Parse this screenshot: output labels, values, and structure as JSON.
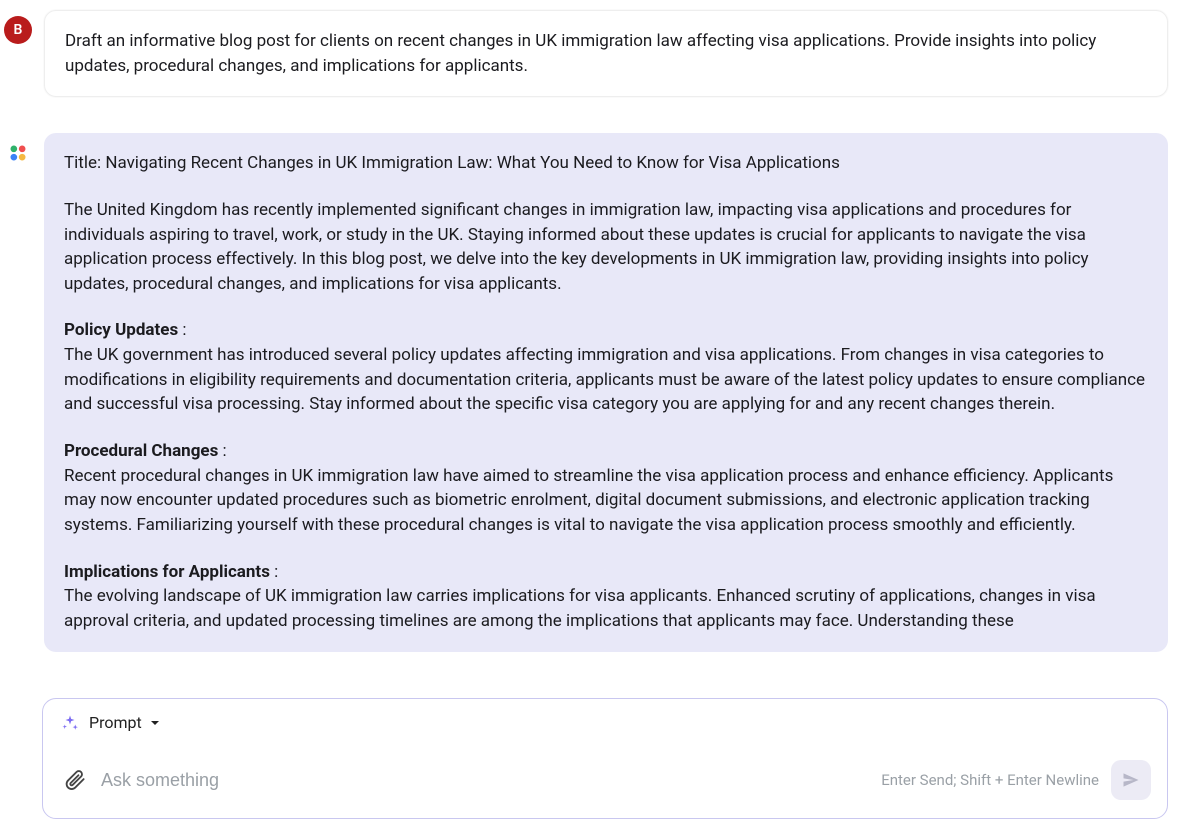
{
  "user": {
    "avatar_letter": "B",
    "message": "Draft an informative blog post for clients on recent changes in UK immigration law affecting visa applications. Provide insights into policy updates, procedural changes, and implications for applicants."
  },
  "assistant": {
    "title_line": "Title: Navigating Recent Changes in UK Immigration Law: What You Need to Know for Visa Applications",
    "intro": "The United Kingdom has recently implemented significant changes in immigration law, impacting visa applications and procedures for individuals aspiring to travel, work, or study in the UK. Staying informed about these updates is crucial for applicants to navigate the visa application process effectively. In this blog post, we delve into the key developments in UK immigration law, providing insights into policy updates, procedural changes, and implications for visa applicants.",
    "sections": [
      {
        "heading": "Policy Updates",
        "colon": " :",
        "body": "The UK government has introduced several policy updates affecting immigration and visa applications. From changes in visa categories to modifications in eligibility requirements and documentation criteria, applicants must be aware of the latest policy updates to ensure compliance and successful visa processing. Stay informed about the specific visa category you are applying for and any recent changes therein."
      },
      {
        "heading": "Procedural Changes",
        "colon": " :",
        "body": "Recent procedural changes in UK immigration law have aimed to streamline the visa application process and enhance efficiency. Applicants may now encounter updated procedures such as biometric enrolment, digital document submissions, and electronic application tracking systems. Familiarizing yourself with these procedural changes is vital to navigate the visa application process smoothly and efficiently."
      },
      {
        "heading": "Implications for Applicants",
        "colon": " :",
        "body": "The evolving landscape of UK immigration law carries implications for visa applicants. Enhanced scrutiny of applications, changes in visa approval criteria, and updated processing timelines are among the implications that applicants may face. Understanding these"
      }
    ]
  },
  "input": {
    "mode_label": "Prompt",
    "placeholder": "Ask something",
    "hint": "Enter Send; Shift + Enter Newline"
  }
}
